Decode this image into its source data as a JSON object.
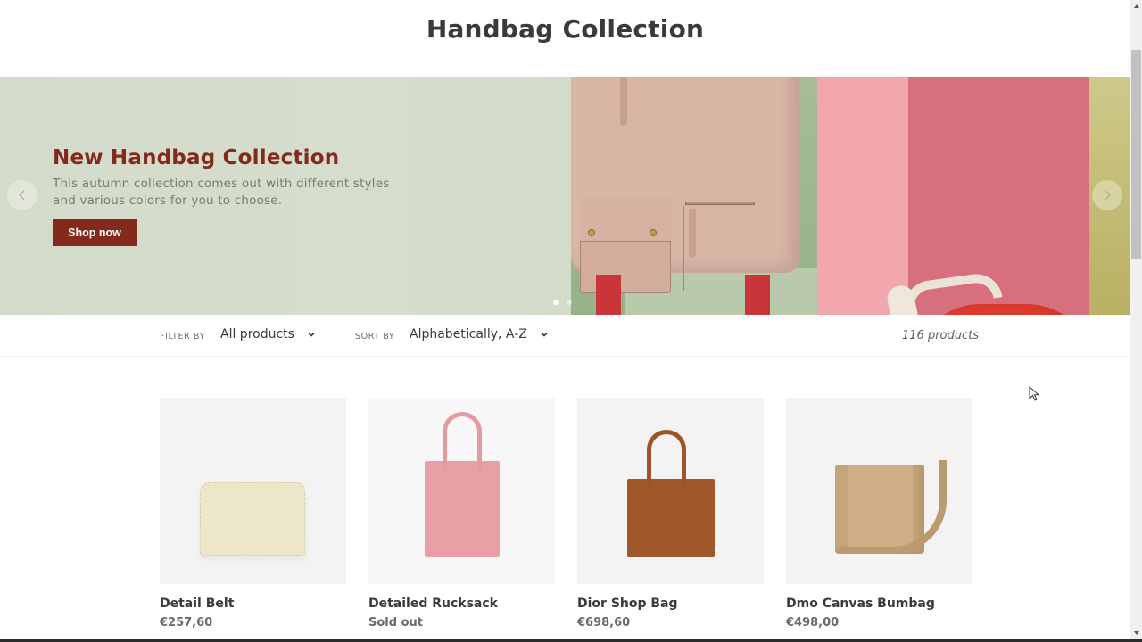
{
  "header": {
    "title": "Handbag Collection"
  },
  "hero": {
    "title": "New Handbag Collection",
    "description": "This autumn collection comes out with different styles and various colors for you to choose.",
    "cta_label": "Shop now",
    "prev_icon": "chevron-left-icon",
    "next_icon": "chevron-right-icon",
    "slides_total": 2,
    "active_slide": 1
  },
  "filter_bar": {
    "filter_label": "Filter by",
    "filter_value": "All products",
    "sort_label": "Sort by",
    "sort_value": "Alphabetically, A-Z",
    "product_count": "116 products"
  },
  "products": [
    {
      "title": "Detail Belt",
      "price": "€257,60"
    },
    {
      "title": "Detailed Rucksack",
      "price": "Sold out"
    },
    {
      "title": "Dior Shop Bag",
      "price": "€698,60"
    },
    {
      "title": "Dmo Canvas Bumbag",
      "price": "€498,00"
    }
  ],
  "colors": {
    "accent": "#832a1d",
    "title_text": "#3a3a3a",
    "muted_text": "#6b6b6b"
  }
}
